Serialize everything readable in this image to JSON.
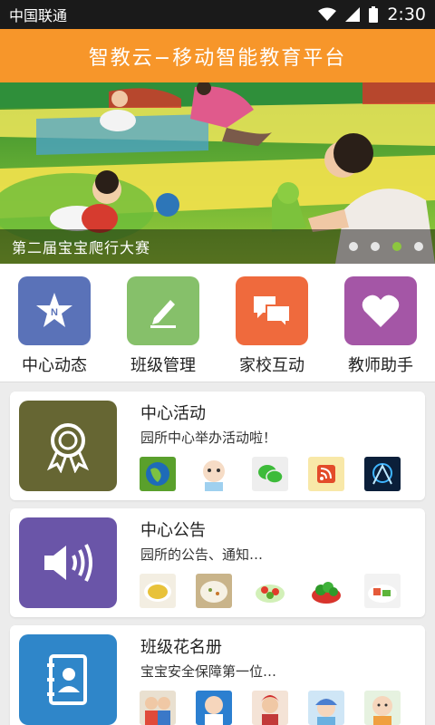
{
  "status_bar": {
    "carrier": "中国联通",
    "time": "2:30"
  },
  "header": {
    "title": "智教云−移动智能教育平台"
  },
  "banner": {
    "caption": "第二届宝宝爬行大赛",
    "dot_count": 4,
    "active_dot": 3
  },
  "quick_nav": [
    {
      "label": "中心动态",
      "icon": "star-n-icon",
      "color": "#5a72b8"
    },
    {
      "label": "班级管理",
      "icon": "pencil-icon",
      "color": "#86c06a"
    },
    {
      "label": "家校互动",
      "icon": "chat-bubbles-icon",
      "color": "#ef6a3d"
    },
    {
      "label": "教师助手",
      "icon": "heart-icon",
      "color": "#a456a6"
    }
  ],
  "cards": [
    {
      "title": "中心活动",
      "description": "园所中心举办活动啦！",
      "icon": "award-ribbon-icon",
      "color": "#666633"
    },
    {
      "title": "中心公告",
      "description": "园所的公告、通知…",
      "icon": "speaker-icon",
      "color": "#6a55a8"
    },
    {
      "title": "班级花名册",
      "description": "宝宝安全保障第一位…",
      "icon": "contact-book-icon",
      "color": "#2f86c9"
    }
  ]
}
